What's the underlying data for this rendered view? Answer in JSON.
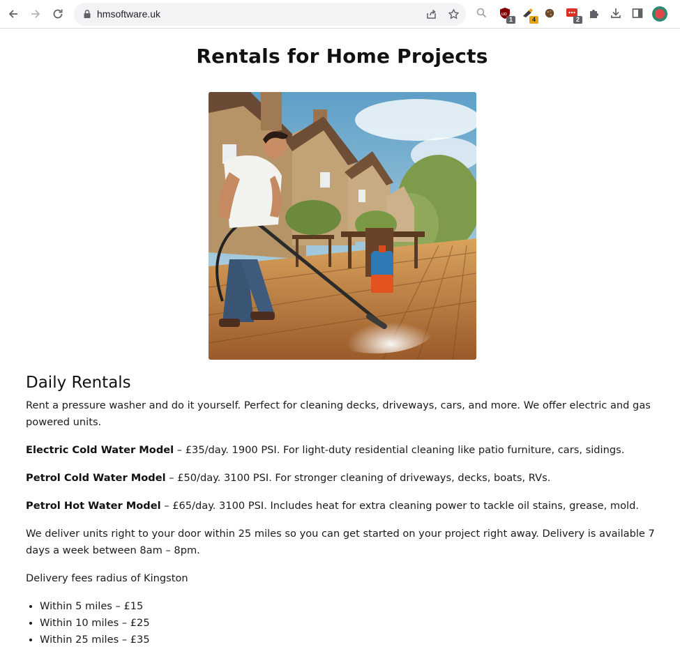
{
  "browser": {
    "url": "hmsoftware.uk",
    "extensions": [
      {
        "name": "ublock-icon",
        "badge": "1",
        "badge_color": "#5f6368"
      },
      {
        "name": "clipper-icon",
        "badge": "4",
        "badge_color": "#e8a317"
      },
      {
        "name": "cookie-icon",
        "badge": ""
      },
      {
        "name": "chat-ext-icon",
        "badge": "2",
        "badge_color": "#5f6368"
      }
    ]
  },
  "page": {
    "title": "Rentals for Home Projects",
    "hero_alt": "Man pressure washing a wooden deck outside stone cottages",
    "section_heading": "Daily Rentals",
    "intro": "Rent a pressure washer and do it yourself. Perfect for cleaning decks, driveways, cars, and more. We offer electric and gas powered units.",
    "models": [
      {
        "name": "Electric Cold Water Model",
        "desc": " – £35/day. 1900 PSI. For light-duty residential cleaning like patio furniture, cars, sidings."
      },
      {
        "name": "Petrol Cold Water Model",
        "desc": " – £50/day. 3100 PSI. For stronger cleaning of driveways, decks, boats, RVs."
      },
      {
        "name": "Petrol Hot Water Model",
        "desc": " – £65/day. 3100 PSI. Includes heat for extra cleaning power to tackle oil stains, grease, mold."
      }
    ],
    "delivery": "We deliver units right to your door within 25 miles so you can get started on your project right away. Delivery is available 7 days a week between 8am – 8pm.",
    "fees_heading": "Delivery fees radius of Kingston",
    "fees": [
      "Within 5 miles – £15",
      "Within 10 miles – £25",
      "Within 25 miles – £35"
    ]
  }
}
